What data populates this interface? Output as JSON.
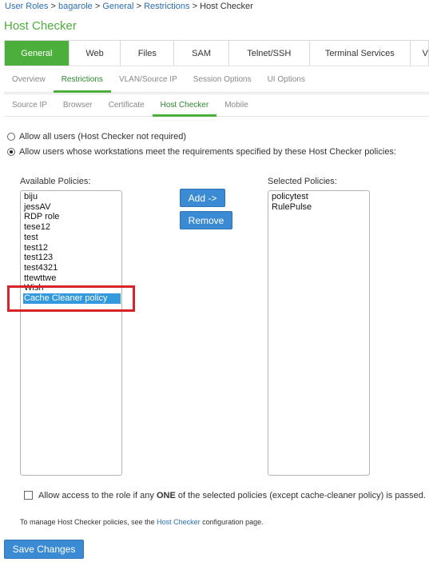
{
  "breadcrumb": {
    "items": [
      "User Roles",
      "bagarole",
      "General",
      "Restrictions"
    ],
    "current": "Host Checker",
    "separator": ">"
  },
  "page_title": "Host Checker",
  "main_tabs": [
    {
      "label": "General",
      "active": true
    },
    {
      "label": "Web"
    },
    {
      "label": "Files"
    },
    {
      "label": "SAM"
    },
    {
      "label": "Telnet/SSH"
    },
    {
      "label": "Terminal Services"
    },
    {
      "label": "V"
    }
  ],
  "sub_tabs": [
    {
      "label": "Overview"
    },
    {
      "label": "Restrictions",
      "active": true
    },
    {
      "label": "VLAN/Source IP"
    },
    {
      "label": "Session Options"
    },
    {
      "label": "UI Options"
    }
  ],
  "restriction_tabs": [
    {
      "label": "Source IP"
    },
    {
      "label": "Browser"
    },
    {
      "label": "Certificate"
    },
    {
      "label": "Host Checker",
      "active": true
    },
    {
      "label": "Mobile"
    }
  ],
  "options": {
    "allow_all": "Allow all users (Host Checker not required)",
    "allow_policies": "Allow users whose workstations meet the requirements specified by these Host Checker policies:"
  },
  "available_label": "Available Policies:",
  "selected_label": "Selected Policies:",
  "available_policies": [
    "biju",
    "jessAV",
    "RDP role",
    "tese12",
    "test",
    "test12",
    "test123",
    "test4321",
    "ttewttwe",
    "Wish",
    "Cache Cleaner policy"
  ],
  "selected_available_policy": "Cache Cleaner policy",
  "selected_policies": [
    "policytest",
    "RulePulse"
  ],
  "buttons": {
    "add": "Add ->",
    "remove": "Remove",
    "save": "Save Changes"
  },
  "checkbox": {
    "prefix": "Allow access to the role if any ",
    "emphasis": "ONE",
    "suffix": " of the selected policies (except cache-cleaner policy) is passed."
  },
  "manage_note": {
    "prefix": "To manage Host Checker policies, see the ",
    "link": "Host Checker",
    "suffix": " configuration page."
  },
  "colors": {
    "accent_green": "#4cae3b",
    "link_blue": "#2a6ebb",
    "button_blue": "#3b8bd4",
    "selection_blue": "#3399dd",
    "highlight_red": "#d9232a"
  }
}
